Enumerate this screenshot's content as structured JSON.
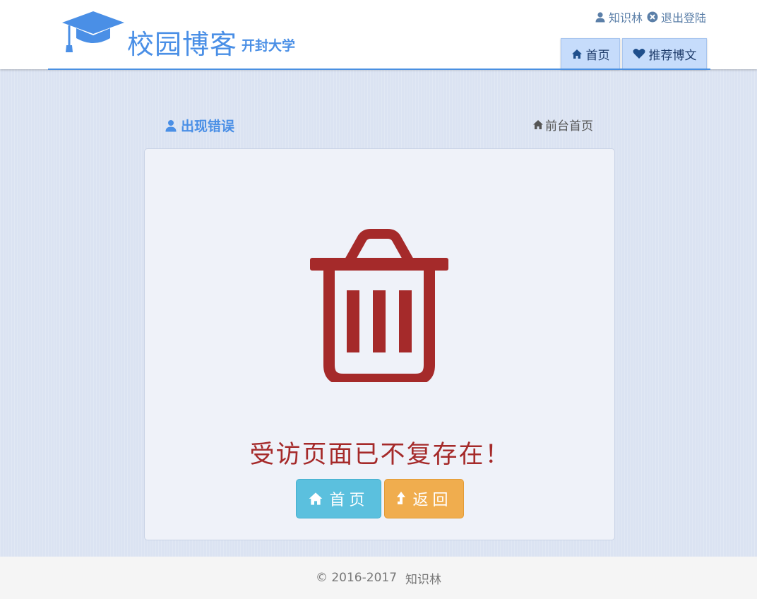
{
  "header": {
    "site_title": "校园博客",
    "site_subtitle": "开封大学",
    "user_name": "知识林",
    "logout_label": "退出登陆",
    "nav": {
      "home_label": "首页",
      "recommend_label": "推荐博文"
    }
  },
  "breadcrumb": {
    "section_title": "出现错误",
    "front_home_label": "前台首页"
  },
  "error_panel": {
    "icon": "trash-icon",
    "message": "受访页面已不复存在！",
    "home_button_label": "首页",
    "back_button_label": "返回"
  },
  "footer": {
    "copyright": "© 2016-2017",
    "author": "知识林"
  },
  "colors": {
    "brand_blue": "#4a8fe6",
    "error_red": "#a52a2a",
    "info_button": "#5bc0de",
    "warning_button": "#f0ad4e",
    "nav_button": "#c6dcfb"
  }
}
